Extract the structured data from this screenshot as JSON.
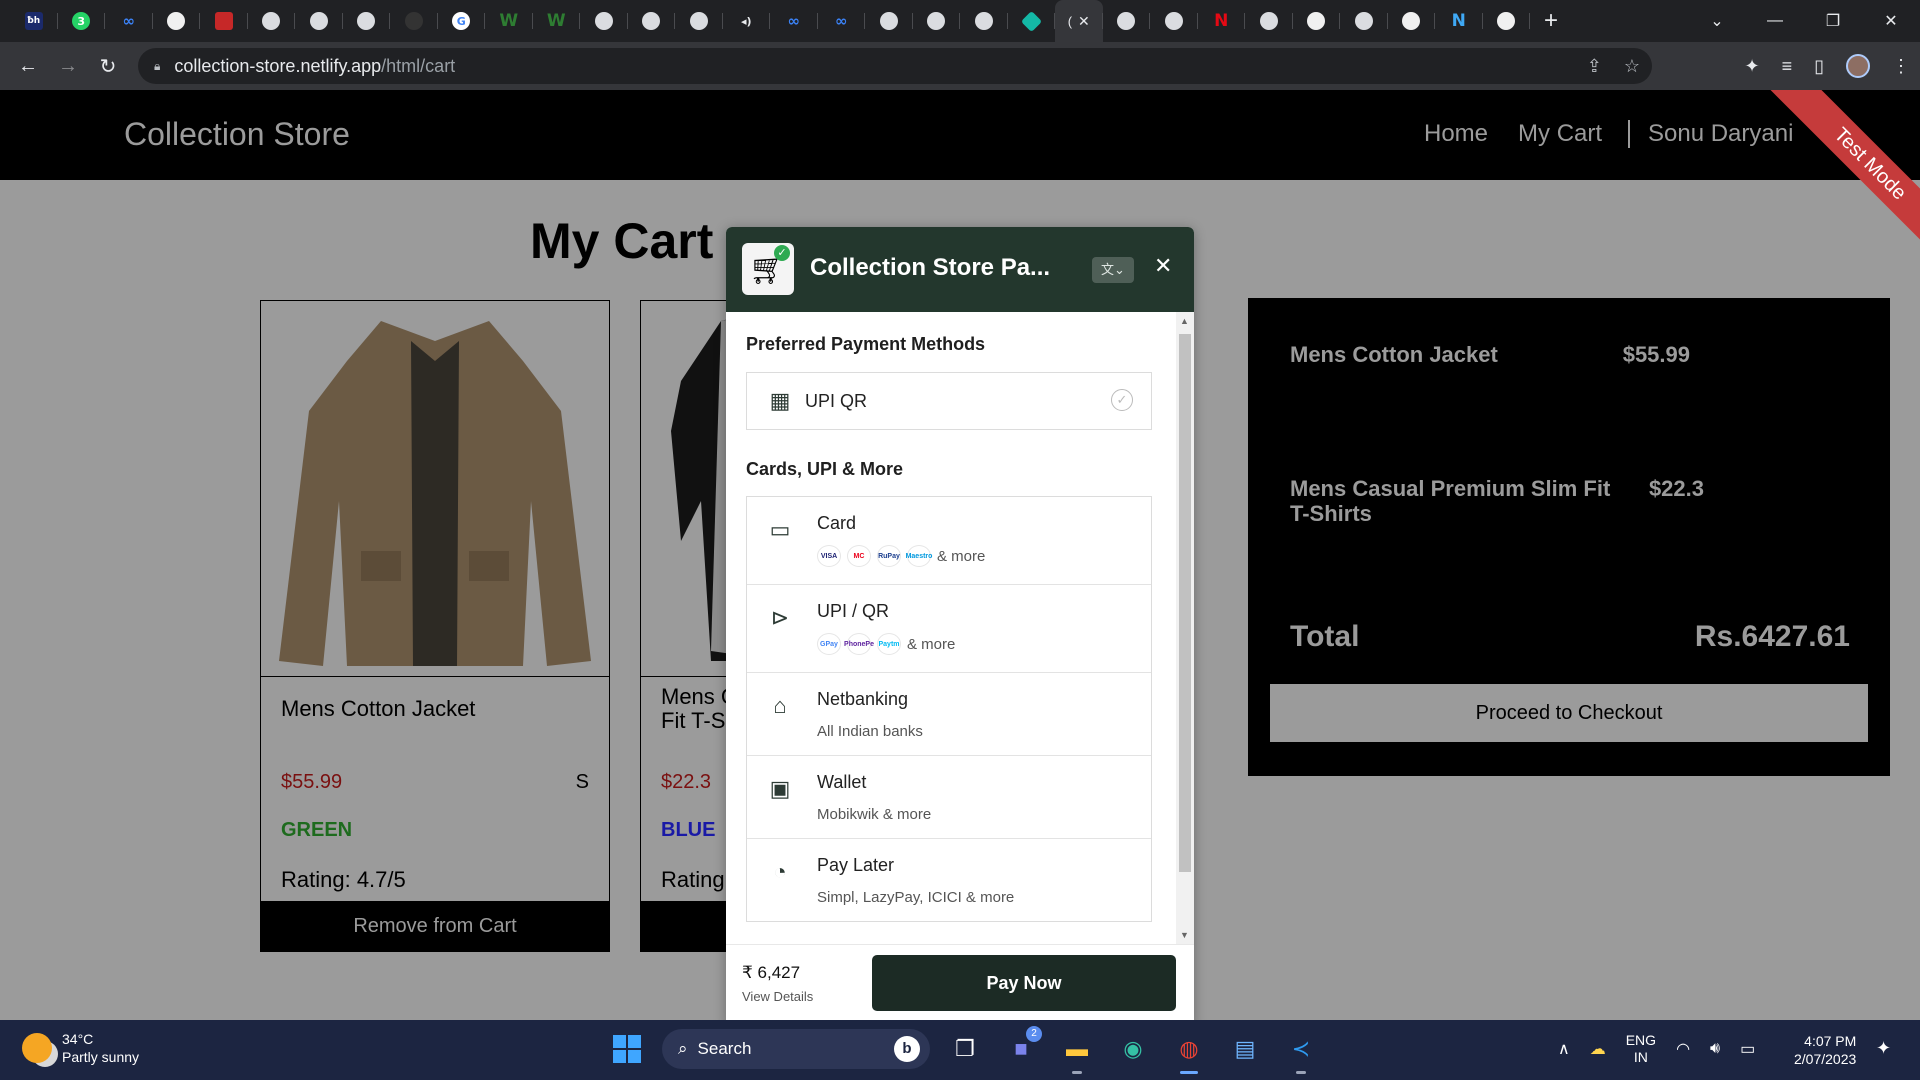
{
  "browser": {
    "tabs": [
      {
        "icon": "tb-favicon-icon",
        "glyph": "ƀh"
      },
      {
        "icon": "whatsapp-icon",
        "glyph": "3"
      },
      {
        "icon": "meta-icon",
        "glyph": "∞"
      },
      {
        "icon": "github-icon",
        "glyph": "●"
      },
      {
        "icon": "calendar-icon",
        "glyph": "▦"
      },
      {
        "icon": "globe-icon",
        "glyph": ""
      },
      {
        "icon": "globe-icon",
        "glyph": ""
      },
      {
        "icon": "globe-icon",
        "glyph": ""
      },
      {
        "icon": "loading-icon",
        "glyph": ""
      },
      {
        "icon": "google-icon",
        "glyph": "G"
      },
      {
        "icon": "w-icon",
        "glyph": "W"
      },
      {
        "icon": "w-icon",
        "glyph": "W"
      },
      {
        "icon": "globe-icon",
        "glyph": ""
      },
      {
        "icon": "globe-icon",
        "glyph": ""
      },
      {
        "icon": "globe-icon",
        "glyph": ""
      },
      {
        "icon": "audio-icon",
        "glyph": "◂)"
      },
      {
        "icon": "meta-icon",
        "glyph": "∞"
      },
      {
        "icon": "meta-icon",
        "glyph": "∞"
      },
      {
        "icon": "globe-icon",
        "glyph": ""
      },
      {
        "icon": "globe-icon",
        "glyph": ""
      },
      {
        "icon": "globe-icon",
        "glyph": ""
      },
      {
        "icon": "diamond-icon",
        "glyph": ""
      },
      {
        "icon": "active-tab-icon",
        "glyph": "("
      },
      {
        "icon": "globe-icon",
        "glyph": ""
      },
      {
        "icon": "globe-icon",
        "glyph": ""
      },
      {
        "icon": "netflix-icon",
        "glyph": "N"
      },
      {
        "icon": "globe-icon",
        "glyph": ""
      },
      {
        "icon": "github-icon",
        "glyph": "●"
      },
      {
        "icon": "globe-icon",
        "glyph": ""
      },
      {
        "icon": "github-icon",
        "glyph": "●"
      },
      {
        "icon": "n-icon",
        "glyph": "N"
      },
      {
        "icon": "github-icon",
        "glyph": "●"
      }
    ],
    "url_host": "collection-store.netlify.app",
    "url_path": "/html/cart"
  },
  "site": {
    "brand": "Collection Store",
    "nav": {
      "home": "Home",
      "cart": "My Cart",
      "user": "Sonu Daryani"
    },
    "ribbon": "Test Mode",
    "page_title": "My Cart"
  },
  "products": [
    {
      "name": "Mens Cotton Jacket",
      "price": "$55.99",
      "size": "S",
      "color": "GREEN",
      "color_hex": "#1e6b1e",
      "rating": "Rating: 4.7/5",
      "remove": "Remove from Cart"
    },
    {
      "name": "Mens Casual Premium Slim Fit T-Shirts",
      "name_visible": "Mens C\nFit T-S",
      "price": "$22.3",
      "size": "",
      "color": "BLUE",
      "color_hex": "#1a1aa6",
      "rating": "Rating:",
      "remove": "Remove from Cart"
    }
  ],
  "summary": {
    "items": [
      {
        "name": "Mens Cotton Jacket",
        "price": "$55.99"
      },
      {
        "name": "Mens Casual Premium Slim Fit T-Shirts",
        "price": "$22.3"
      }
    ],
    "total_label": "Total",
    "total_value": "Rs.6427.61",
    "checkout": "Proceed to Checkout"
  },
  "payment": {
    "title": "Collection Store Pa...",
    "lang_label": "文⌄",
    "preferred_heading": "Preferred Payment Methods",
    "preferred": [
      {
        "label": "UPI QR",
        "icon": "qr-icon"
      }
    ],
    "more_heading": "Cards, UPI & More",
    "options": [
      {
        "title": "Card",
        "sub": "& more",
        "icon": "card-icon",
        "logos": [
          "VISA",
          "MC",
          "RuPay",
          "Maestro"
        ]
      },
      {
        "title": "UPI / QR",
        "sub": "& more",
        "icon": "upi-icon",
        "logos": [
          "GPay",
          "PhonePe",
          "Paytm"
        ]
      },
      {
        "title": "Netbanking",
        "sub": "All Indian banks",
        "icon": "bank-icon"
      },
      {
        "title": "Wallet",
        "sub": "Mobikwik & more",
        "icon": "wallet-icon"
      },
      {
        "title": "Pay Later",
        "sub": "Simpl, LazyPay, ICICI & more",
        "icon": "paylater-icon"
      }
    ],
    "amount": "₹ 6,427",
    "view_details": "View Details",
    "pay_now": "Pay Now"
  },
  "taskbar": {
    "temperature": "34°C",
    "weather": "Partly sunny",
    "search": "Search",
    "teams_badge": "2",
    "lang_top": "ENG",
    "lang_bottom": "IN",
    "time": "4:07 PM",
    "date": "2/07/2023"
  },
  "colors": {
    "modal_header": "#23372d",
    "pay_button": "#1c2b25",
    "ribbon": "#c53b3b"
  }
}
